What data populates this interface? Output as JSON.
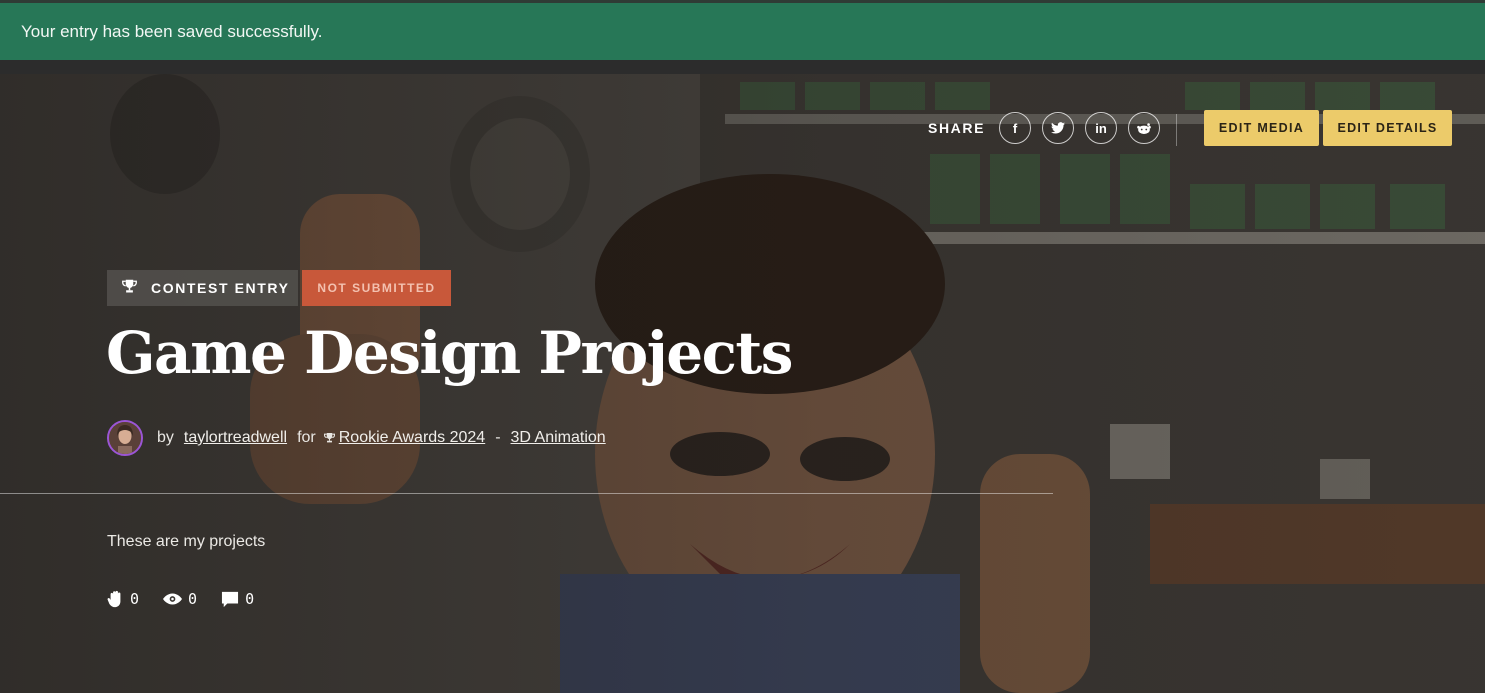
{
  "flash": {
    "message": "Your entry has been saved successfully."
  },
  "share": {
    "label": "SHARE",
    "networks": [
      "f",
      "t",
      "in",
      "r"
    ]
  },
  "actions": {
    "edit_media": "EDIT MEDIA",
    "edit_details": "EDIT DETAILS"
  },
  "entry": {
    "type_label": "CONTEST ENTRY",
    "status": "NOT SUBMITTED",
    "title": "Game Design Projects",
    "by_prefix": "by",
    "author": "taylortreadwell",
    "for_word": "for",
    "contest": "Rookie Awards 2024",
    "separator": "-",
    "category": "3D Animation",
    "description": "These are my projects"
  },
  "stats": {
    "likes": "0",
    "views": "0",
    "comments": "0"
  },
  "colors": {
    "flash": "#277757",
    "button": "#eccb6a",
    "status": "#c8583a",
    "avatar_ring": "#9b55d6"
  }
}
